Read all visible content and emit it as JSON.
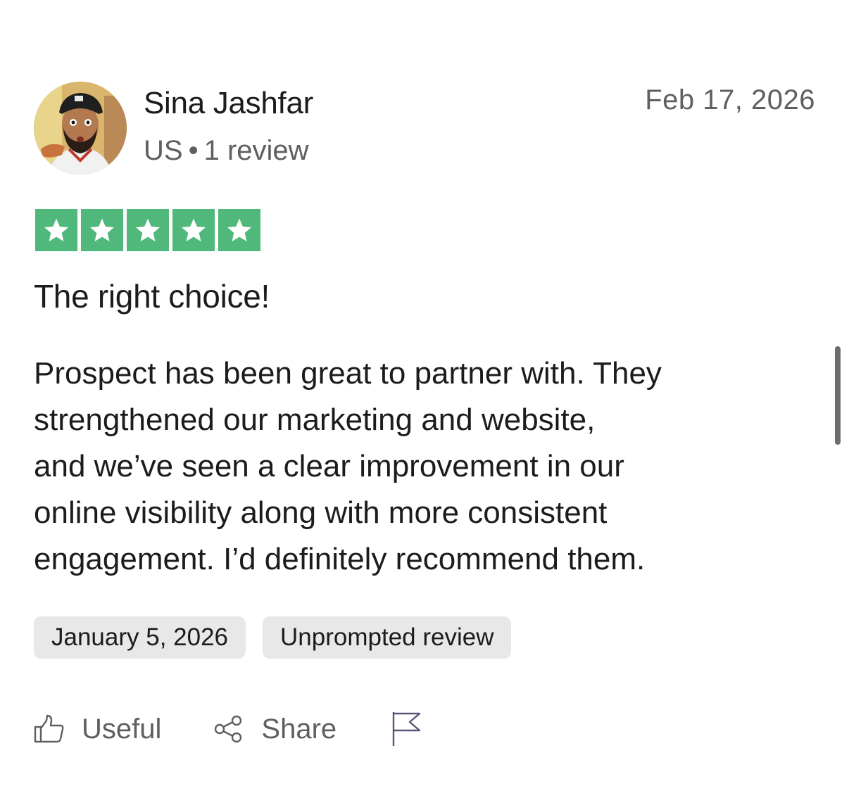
{
  "reviewer": {
    "name": "Sina Jashfar",
    "country": "US",
    "separator": "•",
    "review_count": "1 review"
  },
  "review": {
    "date": "Feb 17, 2026",
    "rating": 5,
    "rating_color": "#4fb87a",
    "title": "The right choice!",
    "body_lines": [
      "Prospect has been great to partner with. They",
      "strengthened our marketing and website,",
      "and we’ve seen a clear improvement in our",
      "online visibility along with more consistent",
      "engagement. I’d definitely recommend them."
    ],
    "experience_date": "January 5, 2026",
    "review_type": "Unprompted review"
  },
  "actions": {
    "useful_label": "Useful",
    "useful_icon": "thumbs-up-icon",
    "share_label": "Share",
    "share_icon": "share-icon",
    "report_icon": "flag-icon"
  }
}
